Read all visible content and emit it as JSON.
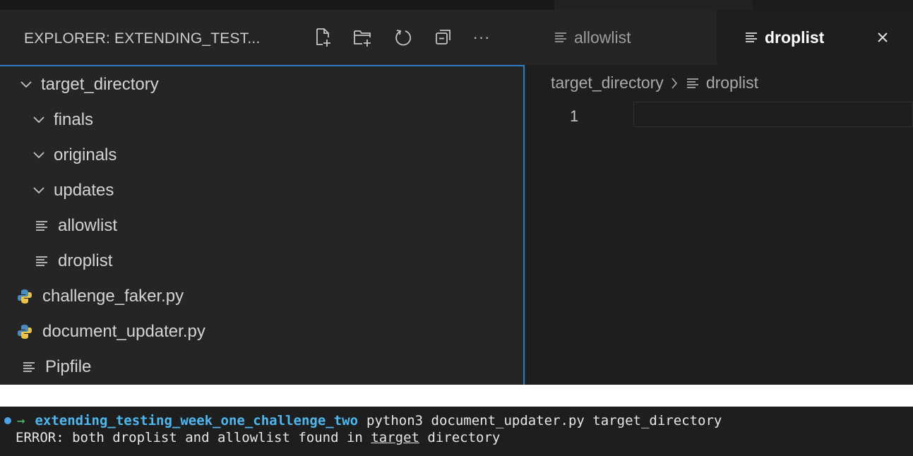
{
  "explorer": {
    "title": "EXPLORER: EXTENDING_TEST...",
    "actions": [
      {
        "icon": "new-file-icon"
      },
      {
        "icon": "new-folder-icon"
      },
      {
        "icon": "refresh-icon"
      },
      {
        "icon": "collapse-all-icon"
      },
      {
        "icon": "more-actions-icon",
        "glyph": "···"
      }
    ],
    "tree": [
      {
        "label": "target_directory",
        "type": "folder"
      },
      {
        "label": "finals",
        "type": "folder"
      },
      {
        "label": "originals",
        "type": "folder"
      },
      {
        "label": "updates",
        "type": "folder"
      },
      {
        "label": "allowlist",
        "type": "file"
      },
      {
        "label": "droplist",
        "type": "file"
      },
      {
        "label": "challenge_faker.py",
        "type": "python"
      },
      {
        "label": "document_updater.py",
        "type": "python"
      },
      {
        "label": "Pipfile",
        "type": "file"
      }
    ]
  },
  "tabs": [
    {
      "label": "allowlist",
      "active": false
    },
    {
      "label": "droplist",
      "active": true
    }
  ],
  "editor": {
    "breadcrumb": [
      "target_directory",
      "droplist"
    ],
    "line_numbers": [
      "1"
    ]
  },
  "terminal": {
    "line1": {
      "directory": "extending_testing_week_one_challenge_two",
      "command": "python3 document_updater.py target_directory"
    },
    "line2": {
      "before": "ERROR: both droplist and allowlist found in ",
      "underlined": "target",
      "after": " directory"
    }
  },
  "colors": {
    "accent_border": "#2f7dc1",
    "python_icon": "#4b8bbe",
    "terminal_dir": "#4fb7ef",
    "terminal_arrow": "#4ec96a",
    "terminal_dot": "#4da3e6"
  }
}
